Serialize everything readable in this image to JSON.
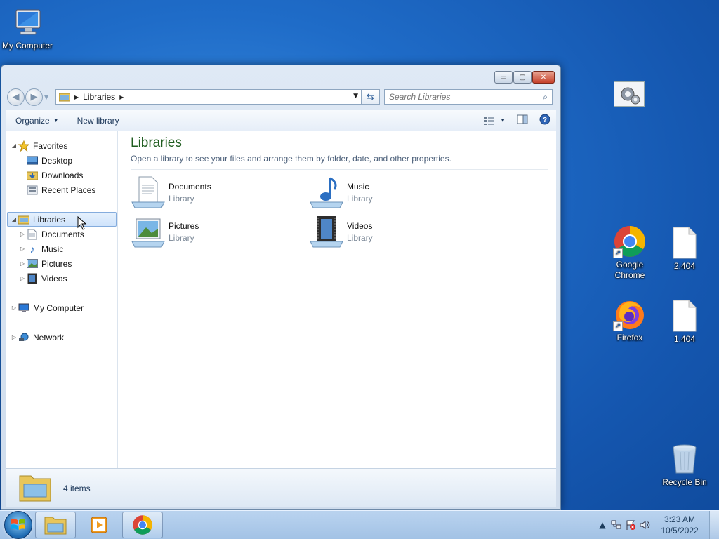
{
  "desktop": {
    "icons": [
      {
        "label": "My Computer"
      },
      {
        "label": "Google Chrome"
      },
      {
        "label": "2.404"
      },
      {
        "label": "Firefox"
      },
      {
        "label": "1.404"
      },
      {
        "label": "Recycle Bin"
      }
    ]
  },
  "window": {
    "controls": {
      "minimize": "▭",
      "maximize": "▢",
      "close": "✕"
    },
    "address": {
      "crumb": "Libraries"
    },
    "search": {
      "placeholder": "Search Libraries"
    },
    "toolbar": {
      "organize": "Organize",
      "new_library": "New library"
    },
    "navpane": {
      "favorites": "Favorites",
      "desktop": "Desktop",
      "downloads": "Downloads",
      "recent_places": "Recent Places",
      "libraries": "Libraries",
      "documents": "Documents",
      "music": "Music",
      "pictures": "Pictures",
      "videos": "Videos",
      "my_computer": "My Computer",
      "network": "Network"
    },
    "main": {
      "title": "Libraries",
      "subtitle": "Open a library to see your files and arrange them by folder, date, and other properties.",
      "libraries": [
        {
          "name": "Documents",
          "type": "Library"
        },
        {
          "name": "Music",
          "type": "Library"
        },
        {
          "name": "Pictures",
          "type": "Library"
        },
        {
          "name": "Videos",
          "type": "Library"
        }
      ]
    },
    "details": {
      "count": "4 items"
    }
  },
  "taskbar": {
    "clock": {
      "time": "3:23 AM",
      "date": "10/5/2022"
    }
  },
  "colors": {
    "title_green": "#1e5c1e",
    "desktop_blue": "#1f6cc8"
  }
}
